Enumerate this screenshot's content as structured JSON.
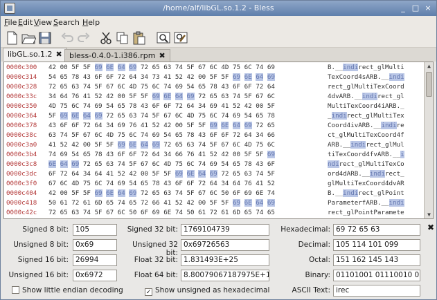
{
  "window": {
    "title": "/home/alf/libGL.so.1.2 - Bless"
  },
  "menu": [
    "File",
    "Edit",
    "View",
    "Search",
    "Help"
  ],
  "tabs": [
    {
      "label": "libGL.so.1.2",
      "close": "✖"
    },
    {
      "label": "bless-0.4.0-1.i386.rpm",
      "close": "✖"
    }
  ],
  "hex_rows": [
    {
      "offset": "0000c300",
      "hex": [
        "42",
        "00",
        "5F",
        "5F",
        "69",
        "6E",
        "64",
        "69",
        "72",
        "65",
        "63",
        "74",
        "5F",
        "67",
        "6C",
        "4D",
        "75",
        "6C",
        "74",
        "69"
      ],
      "hl": [
        4,
        5,
        6,
        7
      ],
      "ascii": [
        [
          "B.__",
          0
        ],
        [
          "indi",
          1
        ],
        [
          "rect_glMulti",
          0
        ]
      ]
    },
    {
      "offset": "0000c314",
      "hex": [
        "54",
        "65",
        "78",
        "43",
        "6F",
        "6F",
        "72",
        "64",
        "34",
        "73",
        "41",
        "52",
        "42",
        "00",
        "5F",
        "5F",
        "69",
        "6E",
        "64",
        "69"
      ],
      "hl": [
        16,
        17,
        18,
        19
      ],
      "ascii": [
        [
          "TexCoord4sARB.__",
          0
        ],
        [
          "indi",
          1
        ]
      ]
    },
    {
      "offset": "0000c328",
      "hex": [
        "72",
        "65",
        "63",
        "74",
        "5F",
        "67",
        "6C",
        "4D",
        "75",
        "6C",
        "74",
        "69",
        "54",
        "65",
        "78",
        "43",
        "6F",
        "6F",
        "72",
        "64"
      ],
      "hl": [],
      "ascii": [
        [
          "rect_glMultiTexCoord",
          0
        ]
      ]
    },
    {
      "offset": "0000c33c",
      "hex": [
        "34",
        "64",
        "76",
        "41",
        "52",
        "42",
        "00",
        "5F",
        "5F",
        "69",
        "6E",
        "64",
        "69",
        "72",
        "65",
        "63",
        "74",
        "5F",
        "67",
        "6C"
      ],
      "hl": [
        9,
        10,
        11,
        12
      ],
      "ascii": [
        [
          "4dvARB.__",
          0
        ],
        [
          "indi",
          1
        ],
        [
          "rect_gl",
          0
        ]
      ]
    },
    {
      "offset": "0000c350",
      "hex": [
        "4D",
        "75",
        "6C",
        "74",
        "69",
        "54",
        "65",
        "78",
        "43",
        "6F",
        "6F",
        "72",
        "64",
        "34",
        "69",
        "41",
        "52",
        "42",
        "00",
        "5F"
      ],
      "hl": [],
      "ascii": [
        [
          "MultiTexCoord4iARB._",
          0
        ]
      ]
    },
    {
      "offset": "0000c364",
      "hex": [
        "5F",
        "69",
        "6E",
        "64",
        "69",
        "72",
        "65",
        "63",
        "74",
        "5F",
        "67",
        "6C",
        "4D",
        "75",
        "6C",
        "74",
        "69",
        "54",
        "65",
        "78"
      ],
      "hl": [
        1,
        2,
        3,
        4
      ],
      "ascii": [
        [
          "_",
          0
        ],
        [
          "indi",
          1
        ],
        [
          "rect_glMultiTex",
          0
        ]
      ]
    },
    {
      "offset": "0000c378",
      "hex": [
        "43",
        "6F",
        "6F",
        "72",
        "64",
        "34",
        "69",
        "76",
        "41",
        "52",
        "42",
        "00",
        "5F",
        "5F",
        "69",
        "6E",
        "64",
        "69",
        "72",
        "65"
      ],
      "hl": [
        14,
        15,
        16,
        17
      ],
      "ascii": [
        [
          "Coord4ivARB.__",
          0
        ],
        [
          "indi",
          1
        ],
        [
          "re",
          0
        ]
      ]
    },
    {
      "offset": "0000c38c",
      "hex": [
        "63",
        "74",
        "5F",
        "67",
        "6C",
        "4D",
        "75",
        "6C",
        "74",
        "69",
        "54",
        "65",
        "78",
        "43",
        "6F",
        "6F",
        "72",
        "64",
        "34",
        "66"
      ],
      "hl": [],
      "ascii": [
        [
          "ct_glMultiTexCoord4f",
          0
        ]
      ]
    },
    {
      "offset": "0000c3a0",
      "hex": [
        "41",
        "52",
        "42",
        "00",
        "5F",
        "5F",
        "69",
        "6E",
        "64",
        "69",
        "72",
        "65",
        "63",
        "74",
        "5F",
        "67",
        "6C",
        "4D",
        "75",
        "6C"
      ],
      "hl": [
        6,
        7,
        8,
        9
      ],
      "ascii": [
        [
          "ARB.__",
          0
        ],
        [
          "indi",
          1
        ],
        [
          "rect_glMul",
          0
        ]
      ]
    },
    {
      "offset": "0000c3b4",
      "hex": [
        "74",
        "69",
        "54",
        "65",
        "78",
        "43",
        "6F",
        "6F",
        "72",
        "64",
        "34",
        "66",
        "76",
        "41",
        "52",
        "42",
        "00",
        "5F",
        "5F",
        "69"
      ],
      "hl": [
        19
      ],
      "ascii": [
        [
          "tiTexCoord4fvARB.__",
          0
        ],
        [
          "i",
          1
        ]
      ]
    },
    {
      "offset": "0000c3c8",
      "hex": [
        "6E",
        "64",
        "69",
        "72",
        "65",
        "63",
        "74",
        "5F",
        "67",
        "6C",
        "4D",
        "75",
        "6C",
        "74",
        "69",
        "54",
        "65",
        "78",
        "43",
        "6F"
      ],
      "hl": [
        0,
        1,
        2
      ],
      "ascii": [
        [
          "ndi",
          1
        ],
        [
          "rect_glMultiTexCo",
          0
        ]
      ]
    },
    {
      "offset": "0000c3dc",
      "hex": [
        "6F",
        "72",
        "64",
        "34",
        "64",
        "41",
        "52",
        "42",
        "00",
        "5F",
        "5F",
        "69",
        "6E",
        "64",
        "69",
        "72",
        "65",
        "63",
        "74",
        "5F"
      ],
      "hl": [
        11,
        12,
        13,
        14
      ],
      "ascii": [
        [
          "ord4dARB.__",
          0
        ],
        [
          "indi",
          1
        ],
        [
          "rect_",
          0
        ]
      ]
    },
    {
      "offset": "0000c3f0",
      "hex": [
        "67",
        "6C",
        "4D",
        "75",
        "6C",
        "74",
        "69",
        "54",
        "65",
        "78",
        "43",
        "6F",
        "6F",
        "72",
        "64",
        "34",
        "64",
        "76",
        "41",
        "52"
      ],
      "hl": [],
      "ascii": [
        [
          "glMultiTexCoord4dvAR",
          0
        ]
      ]
    },
    {
      "offset": "0000c404",
      "hex": [
        "42",
        "00",
        "5F",
        "5F",
        "69",
        "6E",
        "64",
        "69",
        "72",
        "65",
        "63",
        "74",
        "5F",
        "67",
        "6C",
        "50",
        "6F",
        "69",
        "6E",
        "74"
      ],
      "hl": [
        4,
        5,
        6,
        7
      ],
      "ascii": [
        [
          "B.__",
          0
        ],
        [
          "indi",
          1
        ],
        [
          "rect_glPoint",
          0
        ]
      ]
    },
    {
      "offset": "0000c418",
      "hex": [
        "50",
        "61",
        "72",
        "61",
        "6D",
        "65",
        "74",
        "65",
        "72",
        "66",
        "41",
        "52",
        "42",
        "00",
        "5F",
        "5F",
        "69",
        "6E",
        "64",
        "69"
      ],
      "hl": [
        16,
        17,
        18,
        19
      ],
      "ascii": [
        [
          "ParameterfARB.__",
          0
        ],
        [
          "indi",
          1
        ]
      ]
    },
    {
      "offset": "0000c42c",
      "hex": [
        "72",
        "65",
        "63",
        "74",
        "5F",
        "67",
        "6C",
        "50",
        "6F",
        "69",
        "6E",
        "74",
        "50",
        "61",
        "72",
        "61",
        "6D",
        "65",
        "74",
        "65"
      ],
      "hl": [],
      "ascii": [
        [
          "rect_glPointParamete",
          0
        ]
      ]
    }
  ],
  "conversion": {
    "signed8_label": "Signed 8 bit:",
    "signed8": "105",
    "unsigned8_label": "Unsigned 8 bit:",
    "unsigned8": "0x69",
    "signed16_label": "Signed 16 bit:",
    "signed16": "26994",
    "unsigned16_label": "Unsigned 16 bit:",
    "unsigned16": "0x6972",
    "signed32_label": "Signed 32 bit:",
    "signed32": "1769104739",
    "unsigned32_label": "Unsigned 32 bit:",
    "unsigned32": "0x69726563",
    "float32_label": "Float 32 bit:",
    "float32": "1.831493E+25",
    "float64_label": "Float 64 bit:",
    "float64": "8.80079067187975E+199",
    "hex_label": "Hexadecimal:",
    "hex": "69 72 65 63",
    "dec_label": "Decimal:",
    "dec": "105 114 101 099",
    "oct_label": "Octal:",
    "oct": "151 162 145 143",
    "bin_label": "Binary:",
    "bin": "01101001 01110010 011",
    "ascii_label": "ASCII Text:",
    "ascii": "irec",
    "little_endian_label": "Show little endian decoding",
    "little_endian_checked": false,
    "unsigned_hex_label": "Show unsigned as hexadecimal",
    "unsigned_hex_checked": true,
    "close": "✖"
  }
}
